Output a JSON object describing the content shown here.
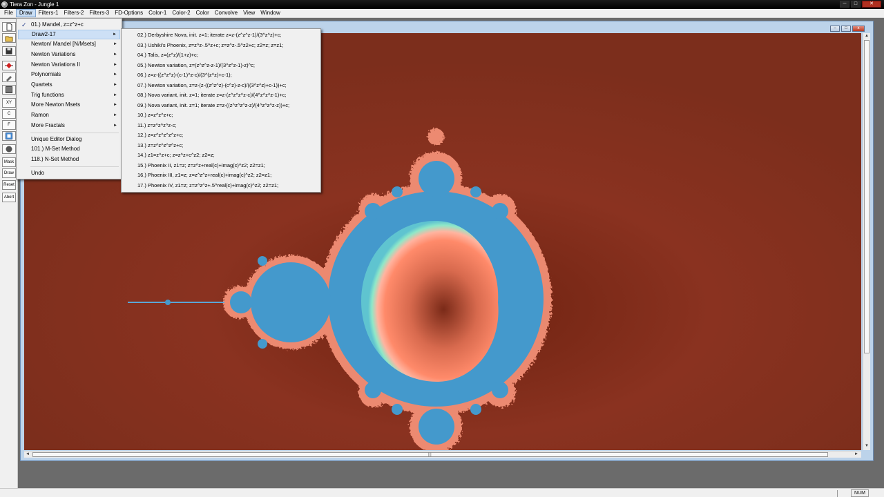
{
  "window": {
    "title": "Tiera Zon - Jungle 1",
    "min_label": "─",
    "max_label": "□",
    "close_label": "✕"
  },
  "menubar": [
    "File",
    "Draw",
    "Filters-1",
    "Filters-2",
    "Filters-3",
    "FD-Options",
    "Color-1",
    "Color-2",
    "Color",
    "Convolve",
    "View",
    "Window"
  ],
  "toolbar": {
    "icons": [
      "new-icon",
      "open-icon",
      "save-icon",
      "zoom-icon",
      "brush-icon",
      "fill-icon",
      "xy-icon",
      "c-icon",
      "f-icon",
      "view-icon",
      "sphere-icon"
    ],
    "labels": [
      "",
      "",
      "",
      "",
      "",
      "",
      "XY",
      "C",
      "F",
      "",
      "",
      "Mask",
      "Draw",
      "Reset",
      "Abort"
    ]
  },
  "draw_menu": {
    "items": [
      {
        "label": "01.) Mandel, z=z^z+c",
        "checked": true,
        "submenu": false
      },
      {
        "label": "Draw2-17",
        "checked": false,
        "submenu": true,
        "highlighted": true
      },
      {
        "label": "Newton/ Mandel [N/Msets]",
        "checked": false,
        "submenu": true
      },
      {
        "label": "Newton Variations",
        "checked": false,
        "submenu": true
      },
      {
        "label": "Newton Variations II",
        "checked": false,
        "submenu": true
      },
      {
        "label": "Polynomials",
        "checked": false,
        "submenu": true
      },
      {
        "label": "Quartets",
        "checked": false,
        "submenu": true
      },
      {
        "label": "Trig functions",
        "checked": false,
        "submenu": true
      },
      {
        "label": "More Newton Msets",
        "checked": false,
        "submenu": true
      },
      {
        "label": "Ramon",
        "checked": false,
        "submenu": true
      },
      {
        "label": "More Fractals",
        "checked": false,
        "submenu": true
      },
      {
        "label": "Unique Editor Dialog",
        "checked": false,
        "submenu": false
      },
      {
        "label": "101.) M-Set Method",
        "checked": false,
        "submenu": false
      },
      {
        "label": "118.) N-Set Method",
        "checked": false,
        "submenu": false
      },
      {
        "label": "Undo",
        "checked": false,
        "submenu": false
      }
    ]
  },
  "submenu": {
    "items": [
      "02.) Derbyshire Nova, init. z=1; iterate z=z-(z^z^z-1)/(3^z^z)+c;",
      "03.) Ushiki's Phoenix, z=z^z-.5^z+c; z=z^z-.5^z2+c; z2=z; z=z1;",
      "04.) Talis, z=(z^z)/(1+z)+c;",
      "05.) Newton variation, z=(z^z^z-z-1)/(3^z^z-1)-z)^c;",
      "06.) z=z-((z^z^z)-(c-1)^z-c)/(3^(z^z)+c-1);",
      "07.) Newton variation, z=z-(z-((z^z^z)-(c^z)-z-c)/((3^z^z)+c-1))+c;",
      "08.) Nova variant, init. z=1; iterate z=z-(z^z^z^z-c)/(4^z^z^z-1)+c;",
      "09.) Nova variant, init. z=1; iterate z=z-((z^z^z^z-z)/(4^z^z^z-z))+c;",
      "10.) z=z^z^z+c;",
      "11.) z=z^z^z^z-c;",
      "12.) z=z^z^z^z^z+c;",
      "13.) z=z^z^z^z^z+c;",
      "14.) z1=z^z+c; z=z^z+c^z2; z2=z;",
      "15.) Phoenix II, z1=z; z=z^z+real(c)+imag(c)^z2; z2=z1;",
      "16.) Phoenix III, z1=z; z=z^z^z+real(c)+imag(c)^z2; z2=z1;",
      "17.) Phoenix IV, z1=z; z=z^z^z+.5^real(c)+imag(c)^z2; z2=z1;"
    ]
  },
  "mdi_child": {
    "min_label": "–",
    "max_label": "□",
    "close_label": "x"
  },
  "scrollbars": {
    "up": "▲",
    "down": "▼",
    "left": "◄",
    "right": "►",
    "grip": "|||"
  },
  "status": {
    "num": "NUM"
  },
  "colors": {
    "background": "#8a3220",
    "fractal_body": "#4499cc",
    "ring_inner": "#ff7f5e",
    "ring_outer": "#88e0c0",
    "edge": "#ff9a80"
  },
  "submenu_arrow": "►",
  "check_mark": "✓"
}
